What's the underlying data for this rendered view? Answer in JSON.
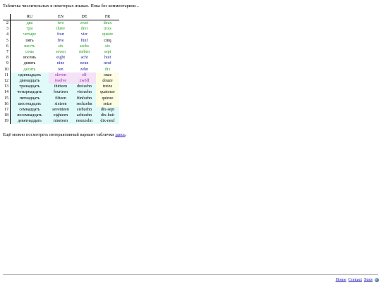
{
  "intro_text": "Табличка числительных в некоторых языках. Пока без комментариев...",
  "table": {
    "headers": [
      "",
      "RU",
      "EN",
      "DE",
      "FR"
    ],
    "rows": [
      {
        "n": "2",
        "ru": "два",
        "en": "two",
        "de": "zwei",
        "fr": "deux",
        "ru_color": "#1e9e1e",
        "en_color": "#1e9e1e",
        "de_color": "#1e9e1e",
        "fr_color": "#1e9e1e",
        "ru_bg": "",
        "en_bg": "",
        "de_bg": "",
        "fr_bg": ""
      },
      {
        "n": "3",
        "ru": "три",
        "en": "three",
        "de": "drei",
        "fr": "trois",
        "ru_color": "#1e9e1e",
        "en_color": "#1e9e1e",
        "de_color": "#1e9e1e",
        "fr_color": "#1e9e1e",
        "ru_bg": "",
        "en_bg": "",
        "de_bg": "",
        "fr_bg": ""
      },
      {
        "n": "4",
        "ru": "четыре",
        "en": "four",
        "de": "vier",
        "fr": "quatre",
        "ru_color": "#1e9e1e",
        "en_color": "#1a1a9c",
        "de_color": "#1a1a9c",
        "fr_color": "#1e9e1e",
        "ru_bg": "",
        "en_bg": "",
        "de_bg": "",
        "fr_bg": ""
      },
      {
        "n": "5",
        "ru": "пять",
        "en": "five",
        "de": "fünf",
        "fr": "cinq",
        "ru_color": "#000000",
        "en_color": "#1a1a9c",
        "de_color": "#1a1a9c",
        "fr_color": "#000000",
        "ru_bg": "",
        "en_bg": "",
        "de_bg": "",
        "fr_bg": ""
      },
      {
        "n": "6",
        "ru": "шесть",
        "en": "six",
        "de": "sechs",
        "fr": "six",
        "ru_color": "#1e9e1e",
        "en_color": "#1e9e1e",
        "de_color": "#1e9e1e",
        "fr_color": "#1e9e1e",
        "ru_bg": "",
        "en_bg": "",
        "de_bg": "",
        "fr_bg": ""
      },
      {
        "n": "7",
        "ru": "семь",
        "en": "seven",
        "de": "sieben",
        "fr": "sept",
        "ru_color": "#1e9e1e",
        "en_color": "#1e9e1e",
        "de_color": "#1e9e1e",
        "fr_color": "#1e9e1e",
        "ru_bg": "",
        "en_bg": "",
        "de_bg": "",
        "fr_bg": ""
      },
      {
        "n": "8",
        "ru": "восемь",
        "en": "eight",
        "de": "acht",
        "fr": "huit",
        "ru_color": "#000000",
        "en_color": "#1a1a9c",
        "de_color": "#1a1a9c",
        "fr_color": "#1a1a9c",
        "ru_bg": "",
        "en_bg": "",
        "de_bg": "",
        "fr_bg": ""
      },
      {
        "n": "9",
        "ru": "девять",
        "en": "nine",
        "de": "neun",
        "fr": "neuf",
        "ru_color": "#000000",
        "en_color": "#1a1a9c",
        "de_color": "#1a1a9c",
        "fr_color": "#1a1a9c",
        "ru_bg": "",
        "en_bg": "",
        "de_bg": "",
        "fr_bg": ""
      },
      {
        "n": "10",
        "ru": "десять",
        "en": "ten",
        "de": "zehn",
        "fr": "dix",
        "ru_color": "#1e9e1e",
        "en_color": "#1a1a9c",
        "de_color": "#1a1a9c",
        "fr_color": "#1e9e1e",
        "ru_bg": "",
        "en_bg": "",
        "de_bg": "",
        "fr_bg": ""
      },
      {
        "n": "11",
        "ru": "одиннадцать",
        "en": "eleven",
        "de": "elf",
        "fr": "onze",
        "ru_color": "#000000",
        "en_color": "#9a1ab0",
        "de_color": "#9a1ab0",
        "fr_color": "#000000",
        "ru_bg": "#e0fafa",
        "en_bg": "#f4e2f7",
        "de_bg": "#f4e2f7",
        "fr_bg": "#fdfde3"
      },
      {
        "n": "12",
        "ru": "двенадцать",
        "en": "twelve",
        "de": "zwölf",
        "fr": "douze",
        "ru_color": "#000000",
        "en_color": "#9a1ab0",
        "de_color": "#9a1ab0",
        "fr_color": "#000000",
        "ru_bg": "#e0fafa",
        "en_bg": "#f4e2f7",
        "de_bg": "#f4e2f7",
        "fr_bg": "#fdfde3"
      },
      {
        "n": "13",
        "ru": "тринадцать",
        "en": "thirteen",
        "de": "dreizehn",
        "fr": "treize",
        "ru_color": "#000000",
        "en_color": "#000000",
        "de_color": "#000000",
        "fr_color": "#000000",
        "ru_bg": "#e0fafa",
        "en_bg": "#e0fafa",
        "de_bg": "#e0fafa",
        "fr_bg": "#fdfde3"
      },
      {
        "n": "14",
        "ru": "четырнадцать",
        "en": "fourteen",
        "de": "vierzehn",
        "fr": "quatorze",
        "ru_color": "#000000",
        "en_color": "#000000",
        "de_color": "#000000",
        "fr_color": "#000000",
        "ru_bg": "#e0fafa",
        "en_bg": "#e0fafa",
        "de_bg": "#e0fafa",
        "fr_bg": "#fdfde3"
      },
      {
        "n": "15",
        "ru": "пятнадцать",
        "en": "fifteen",
        "de": "fünfzehn",
        "fr": "quinze",
        "ru_color": "#000000",
        "en_color": "#000000",
        "de_color": "#000000",
        "fr_color": "#000000",
        "ru_bg": "#e0fafa",
        "en_bg": "#e0fafa",
        "de_bg": "#e0fafa",
        "fr_bg": "#fdfde3"
      },
      {
        "n": "16",
        "ru": "шестнадцать",
        "en": "sixteen",
        "de": "sechzehn",
        "fr": "seize",
        "ru_color": "#000000",
        "en_color": "#000000",
        "de_color": "#000000",
        "fr_color": "#000000",
        "ru_bg": "#e0fafa",
        "en_bg": "#e0fafa",
        "de_bg": "#e0fafa",
        "fr_bg": "#fdfde3"
      },
      {
        "n": "17",
        "ru": "семнадцать",
        "en": "seventeen",
        "de": "siebzehn",
        "fr": "dix-sept",
        "ru_color": "#000000",
        "en_color": "#000000",
        "de_color": "#000000",
        "fr_color": "#000000",
        "ru_bg": "#e0fafa",
        "en_bg": "#e0fafa",
        "de_bg": "#e0fafa",
        "fr_bg": "#e0fafa"
      },
      {
        "n": "18",
        "ru": "восемнадцать",
        "en": "eighteen",
        "de": "achtzehn",
        "fr": "dix-huit",
        "ru_color": "#000000",
        "en_color": "#000000",
        "de_color": "#000000",
        "fr_color": "#000000",
        "ru_bg": "#e0fafa",
        "en_bg": "#e0fafa",
        "de_bg": "#e0fafa",
        "fr_bg": "#e0fafa"
      },
      {
        "n": "19",
        "ru": "девятнадцать",
        "en": "nineteen",
        "de": "neunzehn",
        "fr": "dix-neuf",
        "ru_color": "#000000",
        "en_color": "#000000",
        "de_color": "#000000",
        "fr_color": "#000000",
        "ru_bg": "#e0fafa",
        "en_bg": "#e0fafa",
        "de_bg": "#e0fafa",
        "fr_bg": "#e0fafa"
      }
    ]
  },
  "outro": {
    "text": "Ещё можно посмотреть интерактивный вариант таблички ",
    "link_label": "здесь",
    "suffix": "."
  },
  "footer": {
    "links": [
      "Home",
      "Contact",
      "Stats"
    ],
    "icon": "globe-icon"
  }
}
